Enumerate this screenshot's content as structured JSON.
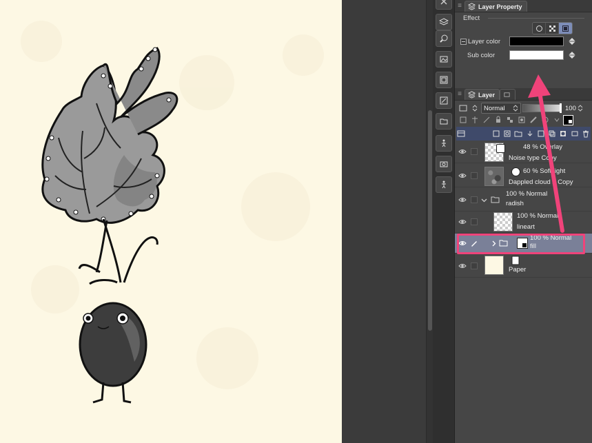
{
  "colors": {
    "canvas_bg": "#fdf8e4",
    "panel_bg": "#464646",
    "selected_row": "#7a8098",
    "highlight": "#f0437a",
    "layer_color": "#000000",
    "sub_color": "#ffffff"
  },
  "tool_strip": {
    "icons": [
      "close-icon",
      "layers-stack-icon",
      "brush-icon",
      "image-icon",
      "image-frame-icon",
      "transform-icon",
      "folder-icon",
      "figure-icon",
      "camera-icon",
      "figure-alt-icon"
    ]
  },
  "layer_property": {
    "tab_label": "Layer Property",
    "effect_label": "Effect",
    "layer_color_label": "Layer color",
    "sub_color_label": "Sub color"
  },
  "layer_panel": {
    "tab_label": "Layer",
    "blend_mode": "Normal",
    "opacity": "100",
    "layers": [
      {
        "top": "48 % Overlay",
        "bottom": "Noise type Copy",
        "thumb": "checker",
        "visible": true
      },
      {
        "top": "60 % Soft light",
        "bottom": "Dappled cloud 2 Copy",
        "thumb": "dark",
        "visible": true
      },
      {
        "top": "100 % Normal",
        "bottom": "radish",
        "thumb": "folder",
        "visible": true
      },
      {
        "top": "100 % Normal",
        "bottom": "lineart",
        "thumb": "checker",
        "visible": true
      },
      {
        "top": "100 % Normal",
        "bottom": "fill",
        "thumb": "folder",
        "visible": true,
        "selected": true
      },
      {
        "top": "",
        "bottom": "Paper",
        "thumb": "paper",
        "visible": true
      }
    ]
  }
}
